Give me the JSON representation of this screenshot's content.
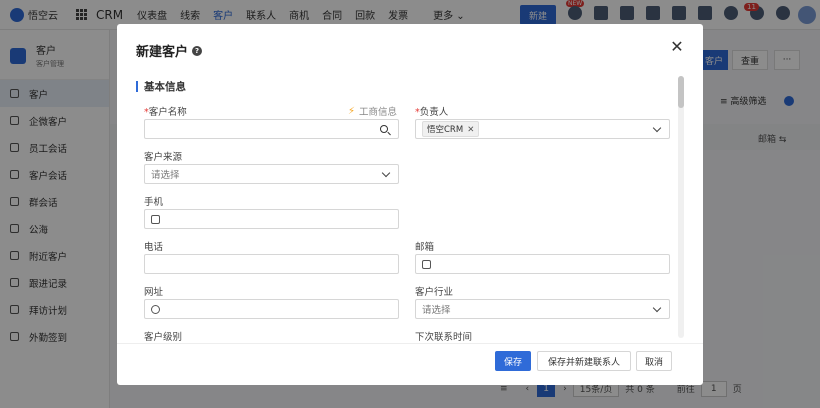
{
  "topbar": {
    "logo_text": "悟空云",
    "app_name": "CRM",
    "nav": [
      "仪表盘",
      "线索",
      "客户",
      "联系人",
      "商机",
      "合同",
      "回款",
      "发票"
    ],
    "active_nav": "客户",
    "more": "更多",
    "new_button": "新建",
    "new_tag": "NEW",
    "notification_count": "11"
  },
  "sidebar": {
    "title": "客户",
    "subtitle": "客户管理",
    "items": [
      "客户",
      "企微客户",
      "员工会话",
      "客户会话",
      "群会话",
      "公海",
      "附近客户",
      "跟进记录",
      "拜访计划",
      "外勤签到"
    ],
    "active": "客户"
  },
  "background": {
    "new_customer_btn": "客户",
    "query_btn": "查重",
    "more_btn": "···",
    "advanced_filter": "高级筛选",
    "table_column_email": "邮箱",
    "pager": {
      "current_page": "1",
      "page_size": "15条/页",
      "total": "共 0 条",
      "goto_label": "前往",
      "goto_value": "1",
      "page_unit": "页"
    }
  },
  "modal": {
    "title": "新建客户",
    "section_title": "基本信息",
    "fields": {
      "customer_name": {
        "label": "客户名称",
        "required": true,
        "biz_info": "工商信息"
      },
      "owner": {
        "label": "负责人",
        "required": true,
        "tag": "悟空CRM"
      },
      "source": {
        "label": "客户来源",
        "placeholder": "请选择"
      },
      "mobile": {
        "label": "手机"
      },
      "phone": {
        "label": "电话"
      },
      "email": {
        "label": "邮箱"
      },
      "website": {
        "label": "网址"
      },
      "industry": {
        "label": "客户行业",
        "placeholder": "请选择"
      },
      "level": {
        "label": "客户级别"
      },
      "next_contact": {
        "label": "下次联系时间"
      }
    },
    "buttons": {
      "save": "保存",
      "save_and_new_contact": "保存并新建联系人",
      "cancel": "取消"
    }
  },
  "colors": {
    "primary": "#2f6bd8",
    "required": "#e53935"
  }
}
